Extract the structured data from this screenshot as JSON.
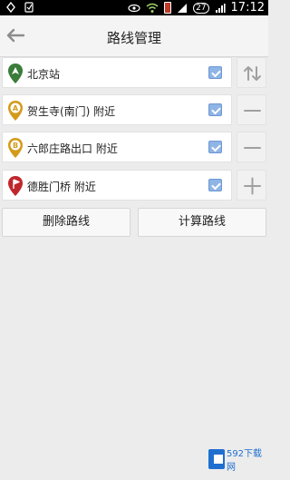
{
  "status_bar": {
    "time": "17:12",
    "calendar": "27"
  },
  "header": {
    "title": "路线管理"
  },
  "route": [
    {
      "label": "北京站",
      "pin": "start",
      "pin_letter": "",
      "pin_color": "#3a7d3a",
      "side": "swap"
    },
    {
      "label": "贺生寺(南门) 附近",
      "pin": "waypoint",
      "pin_letter": "A",
      "pin_color": "#d49a1b",
      "side": "remove"
    },
    {
      "label": "六郎庄路出口 附近",
      "pin": "waypoint",
      "pin_letter": "B",
      "pin_color": "#d49a1b",
      "side": "remove"
    },
    {
      "label": "德胜门桥 附近",
      "pin": "end",
      "pin_letter": "",
      "pin_color": "#c0272d",
      "side": "add"
    }
  ],
  "actions": {
    "delete_label": "删除路线",
    "calculate_label": "计算路线"
  },
  "watermark": {
    "text": "592下载网"
  }
}
